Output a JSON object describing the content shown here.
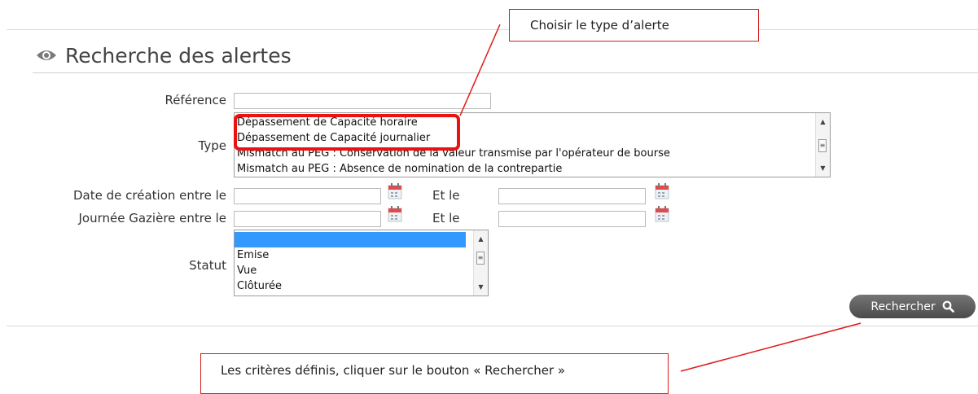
{
  "panel": {
    "title": "Recherche des alertes"
  },
  "form": {
    "reference": {
      "label": "Référence",
      "value": ""
    },
    "type": {
      "label": "Type",
      "options": [
        "Dépassement de Capacité horaire",
        "Dépassement de Capacité journalier",
        "Mismatch au PEG : Conservation de la valeur transmise par l'opérateur de bourse",
        "Mismatch au PEG : Absence de nomination de la contrepartie"
      ]
    },
    "date_creation": {
      "label": "Date de création entre le",
      "and_label": "Et le",
      "from": "",
      "to": ""
    },
    "journee_gaziere": {
      "label": "Journée Gazière entre le",
      "and_label": "Et le",
      "from": "",
      "to": ""
    },
    "statut": {
      "label": "Statut",
      "options": [
        "",
        "Emise",
        "Vue",
        "Clôturée"
      ],
      "selected_index": 0
    },
    "search_button": "Rechercher"
  },
  "annotations": {
    "callout_top": "Choisir le type d’alerte",
    "callout_bottom": "Les critères définis, cliquer sur le bouton « Rechercher »"
  },
  "colors": {
    "annotation_red": "#e01a1a",
    "selection_blue": "#3399ff",
    "button_gray": "#5a5a5a"
  }
}
